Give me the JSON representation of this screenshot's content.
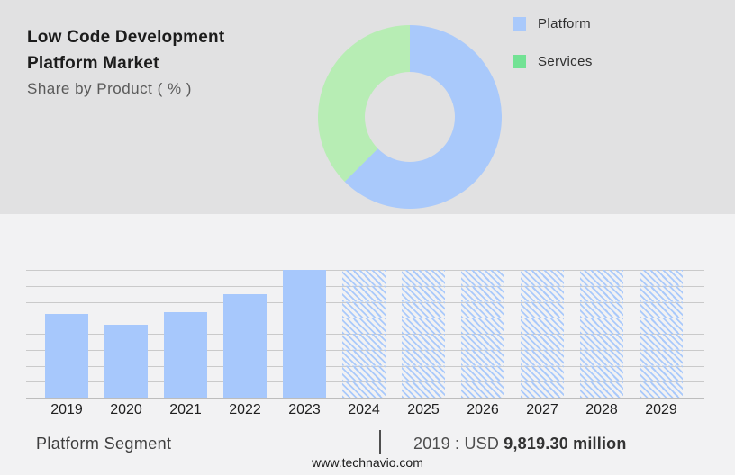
{
  "header": {
    "title": "Low Code Development Platform Market",
    "subtitle": "Share by Product ( % )"
  },
  "colors": {
    "top_background": "#e1e1e2",
    "bottom_background": "#f2f2f3",
    "gridline": "#cacaca"
  },
  "chart_data": [
    {
      "type": "pie",
      "subtype": "donut",
      "title": "Share by Product ( % )",
      "legend_position": "right",
      "start_angle_deg": 0,
      "inner_radius_ratio": 0.49,
      "segments": [
        {
          "label": "Platform",
          "value": 62.5,
          "color": "#a9c9fb",
          "legend_color": "#a9c9fb"
        },
        {
          "label": "Services",
          "value": 37.5,
          "color": "#b7edb4",
          "legend_color": "#72e294"
        }
      ],
      "note": "Slice values estimated from arc angles; no numeric labels shown in image"
    },
    {
      "type": "bar",
      "title": "Platform Segment",
      "categories": [
        "2019",
        "2020",
        "2021",
        "2022",
        "2023",
        "2024",
        "2025",
        "2026",
        "2027",
        "2028",
        "2029"
      ],
      "values": [
        65.5,
        57,
        66.9,
        81,
        100,
        100,
        100,
        100,
        100,
        100,
        100
      ],
      "forecast": [
        false,
        false,
        false,
        false,
        false,
        true,
        true,
        true,
        true,
        true,
        true
      ],
      "unit": "relative bar height, % of 2023 maximum (y-axis unlabeled); 2024-2029 shown as full-height hatched forecast bars",
      "known_point": {
        "category": "2019",
        "value_label": "USD 9,819.30 million"
      },
      "ylim": [
        0,
        100
      ],
      "grid": true,
      "gridline_count": 9,
      "bar_color": "#a7c8fc",
      "hatch_color": "#a9c9fb"
    }
  ],
  "footer": {
    "segment_label": "Platform Segment",
    "separator": "|",
    "value_prefix": "2019 : USD ",
    "value_bold": "9,819.30 million",
    "website": "www.technavio.com"
  }
}
